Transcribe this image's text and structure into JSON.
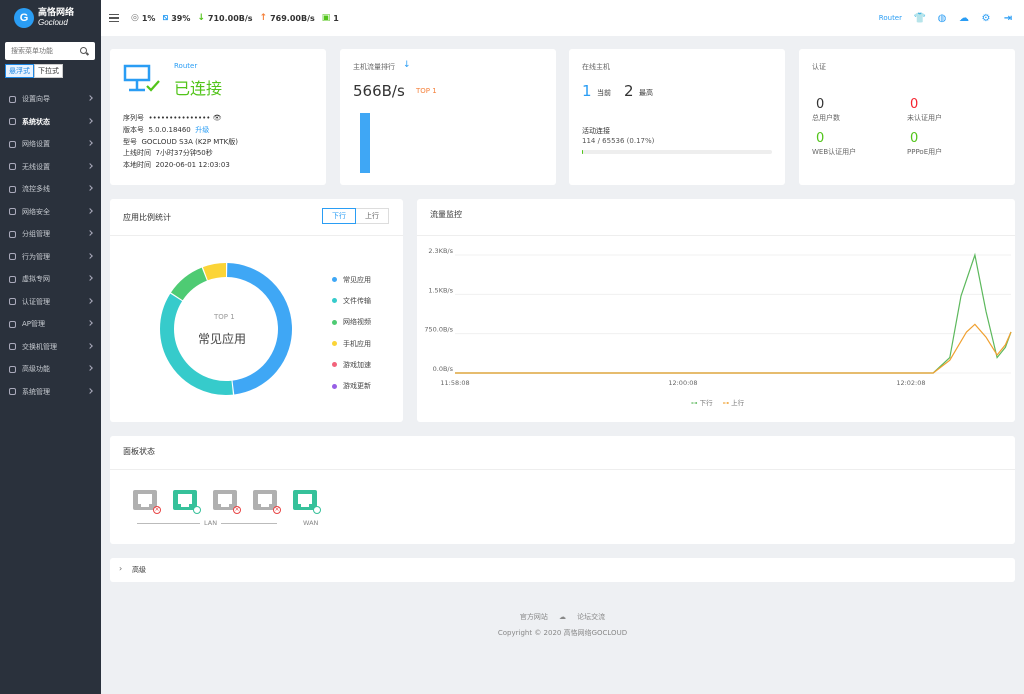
{
  "brand": {
    "name_cn": "高恪网络",
    "name_en": "Gocloud",
    "logo_letter": "G"
  },
  "sidebar": {
    "search_placeholder": "搜索菜单功能",
    "modes": [
      "悬浮式",
      "下拉式"
    ],
    "items": [
      {
        "label": "设置向导"
      },
      {
        "label": "系统状态",
        "active": true
      },
      {
        "label": "网络设置"
      },
      {
        "label": "无线设置"
      },
      {
        "label": "流控多线"
      },
      {
        "label": "网络安全"
      },
      {
        "label": "分组管理"
      },
      {
        "label": "行为管理"
      },
      {
        "label": "虚拟专网"
      },
      {
        "label": "认证管理"
      },
      {
        "label": "AP管理"
      },
      {
        "label": "交换机管理"
      },
      {
        "label": "高级功能"
      },
      {
        "label": "系统管理"
      }
    ]
  },
  "topbar": {
    "cpu": "1%",
    "mem": "39%",
    "down": "710.00B/s",
    "up": "769.00B/s",
    "hosts": "1",
    "router_label": "Router",
    "icons": [
      "shirt-icon",
      "globe-icon",
      "cloud-upload-icon",
      "gear-icon",
      "logout-icon"
    ]
  },
  "router_card": {
    "link": "Router",
    "status": "已连接",
    "serial_label": "序列号",
    "serial_value": "•••••••••••••••",
    "version_label": "版本号",
    "version_value": "5.0.0.18460",
    "upgrade": "升级",
    "model_label": "型号",
    "model_value": "GOCLOUD S3A (K2P MTK版)",
    "uptime_label": "上线时间",
    "uptime_value": "7小时37分钟50秒",
    "localtime_label": "本地时间",
    "localtime_value": "2020-06-01 12:03:03"
  },
  "host_traffic": {
    "title": "主机流量排行",
    "value": "566B/s",
    "badge": "TOP 1"
  },
  "online_hosts": {
    "title": "在线主机",
    "current_value": "1",
    "current_label": "当前",
    "max_value": "2",
    "max_label": "最高",
    "conn_label": "活动连接",
    "conn_value": "114 / 65536 (0.17%)",
    "conn_ratio": 0.0017
  },
  "auth": {
    "title": "认证",
    "total_value": "0",
    "total_label": "总用户数",
    "unauth_value": "0",
    "unauth_label": "未认证用户",
    "web_value": "0",
    "web_label": "WEB认证用户",
    "pppoe_value": "0",
    "pppoe_label": "PPPoE用户"
  },
  "app_stats": {
    "title": "应用比例统计",
    "tab_down": "下行",
    "tab_up": "上行",
    "center_top": "TOP 1",
    "center_label": "常见应用",
    "legend": [
      {
        "name": "常见应用",
        "color": "#3fa7f5"
      },
      {
        "name": "文件传输",
        "color": "#36cbcb"
      },
      {
        "name": "网络视频",
        "color": "#4ecb73"
      },
      {
        "name": "手机应用",
        "color": "#fbd437"
      },
      {
        "name": "游戏加速",
        "color": "#f2637b"
      },
      {
        "name": "游戏更新",
        "color": "#975fe5"
      }
    ]
  },
  "chart_data": {
    "type": "line",
    "title": "流量监控",
    "y_ticks": [
      "2.3KB/s",
      "1.5KB/s",
      "750.0B/s",
      "0.0B/s"
    ],
    "x_ticks": [
      "11:58:08",
      "12:00:08",
      "12:02:08"
    ],
    "ylim": [
      0,
      2300
    ],
    "series": [
      {
        "name": "下行",
        "color": "#5cb85c",
        "points": [
          [
            0,
            0
          ],
          [
            0.86,
            0
          ],
          [
            0.89,
            300
          ],
          [
            0.91,
            1500
          ],
          [
            0.935,
            2300
          ],
          [
            0.955,
            1200
          ],
          [
            0.975,
            300
          ],
          [
            0.99,
            500
          ],
          [
            1.0,
            800
          ]
        ]
      },
      {
        "name": "上行",
        "color": "#f0a030",
        "points": [
          [
            0,
            0
          ],
          [
            0.86,
            0
          ],
          [
            0.89,
            250
          ],
          [
            0.92,
            800
          ],
          [
            0.935,
            950
          ],
          [
            0.955,
            700
          ],
          [
            0.975,
            350
          ],
          [
            0.99,
            550
          ],
          [
            1.0,
            800
          ]
        ]
      }
    ]
  },
  "donut": [
    {
      "name": "常见应用",
      "value": 0.48,
      "color": "#3fa7f5"
    },
    {
      "name": "文件传输",
      "value": 0.36,
      "color": "#36cbcb"
    },
    {
      "name": "网络视频",
      "value": 0.1,
      "color": "#4ecb73"
    },
    {
      "name": "手机应用",
      "value": 0.06,
      "color": "#fbd437"
    }
  ],
  "panel": {
    "title": "面板状态",
    "lan_label": "LAN",
    "wan_label": "WAN",
    "ports": [
      {
        "connected": false
      },
      {
        "connected": true
      },
      {
        "connected": false
      },
      {
        "connected": false
      },
      {
        "connected": true,
        "wan": true
      }
    ]
  },
  "advanced": {
    "label": "高级"
  },
  "footer": {
    "official": "官方网站",
    "forum": "论坛交流",
    "copyright": "Copyright © 2020 高恪网络GOCLOUD"
  }
}
